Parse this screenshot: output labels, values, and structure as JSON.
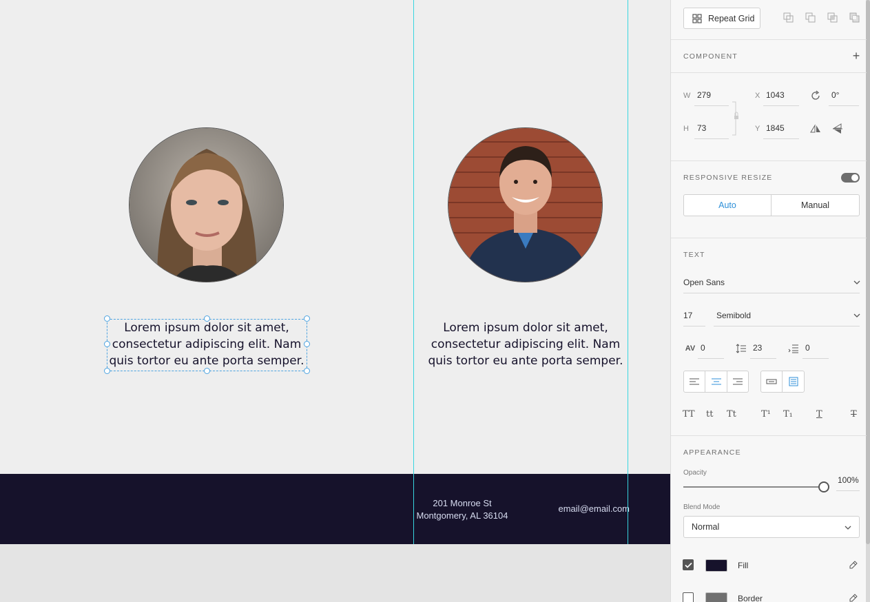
{
  "canvas": {
    "bio_text_left": "Lorem ipsum dolor sit amet, consectetur adipiscing elit. Nam quis tortor eu ante porta semper.",
    "bio_text_right": "Lorem ipsum dolor sit amet, consectetur adipiscing elit. Nam quis tortor eu ante porta semper.",
    "footer_address_line1": "201 Monroe St",
    "footer_address_line2": "Montgomery, AL 36104",
    "footer_email": "email@email.com",
    "colors": {
      "artboard": "#eeeeee",
      "footer": "#16122b",
      "guide": "#37d6e0",
      "selection": "#4da3e0"
    }
  },
  "inspector": {
    "repeat_grid_label": "Repeat Grid",
    "component": {
      "title": "COMPONENT"
    },
    "transform": {
      "w_label": "W",
      "w_value": "279",
      "h_label": "H",
      "h_value": "73",
      "x_label": "X",
      "x_value": "1043",
      "y_label": "Y",
      "y_value": "1845",
      "rotation_value": "0°"
    },
    "responsive": {
      "title": "RESPONSIVE RESIZE",
      "auto_label": "Auto",
      "manual_label": "Manual",
      "enabled": true
    },
    "text": {
      "title": "TEXT",
      "font_family": "Open Sans",
      "font_size": "17",
      "font_weight": "Semibold",
      "char_spacing": "0",
      "line_spacing": "23",
      "paragraph_spacing": "0",
      "case_icons": [
        "TT",
        "tt",
        "Tt"
      ],
      "script_icons": [
        "T¹",
        "T₁"
      ],
      "decoration_icons": [
        "T",
        "T"
      ]
    },
    "appearance": {
      "title": "APPEARANCE",
      "opacity_label": "Opacity",
      "opacity_value": "100%",
      "opacity_fraction": 1.0,
      "blend_label": "Blend Mode",
      "blend_value": "Normal",
      "fill_label": "Fill",
      "fill_checked": true,
      "fill_color": "#16122b",
      "border_label": "Border",
      "border_checked": false,
      "border_color": "#707070"
    }
  }
}
